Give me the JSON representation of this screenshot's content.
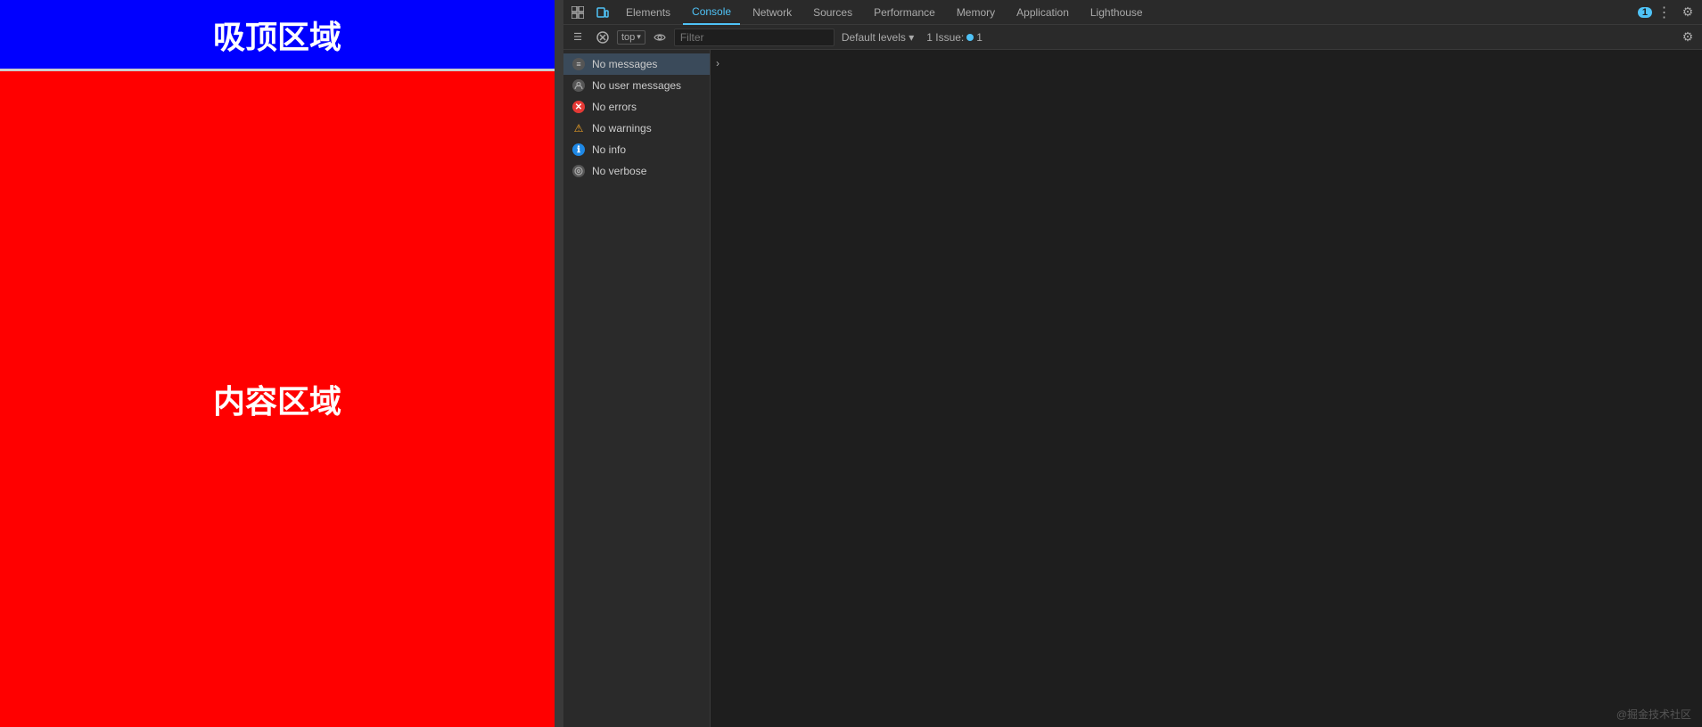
{
  "page": {
    "sticky_header_text": "吸顶区域",
    "content_text": "内容区域"
  },
  "devtools": {
    "tabs": [
      {
        "label": "Elements",
        "active": false
      },
      {
        "label": "Console",
        "active": true
      },
      {
        "label": "Network",
        "active": false
      },
      {
        "label": "Sources",
        "active": false
      },
      {
        "label": "Performance",
        "active": false
      },
      {
        "label": "Memory",
        "active": false
      },
      {
        "label": "Application",
        "active": false
      },
      {
        "label": "Lighthouse",
        "active": false
      }
    ],
    "toolbar": {
      "top_label": "top",
      "filter_placeholder": "Filter",
      "default_levels_label": "Default levels ▾",
      "issues_label": "1 Issue:",
      "issues_count": "1"
    },
    "console_items": [
      {
        "icon": "msgs",
        "label": "No messages",
        "selected": true
      },
      {
        "icon": "user",
        "label": "No user messages",
        "selected": false
      },
      {
        "icon": "error",
        "label": "No errors",
        "selected": false
      },
      {
        "icon": "warn",
        "label": "No warnings",
        "selected": false
      },
      {
        "icon": "info",
        "label": "No info",
        "selected": false
      },
      {
        "icon": "verbose",
        "label": "No verbose",
        "selected": false
      }
    ]
  },
  "watermark": "@掘金技术社区"
}
